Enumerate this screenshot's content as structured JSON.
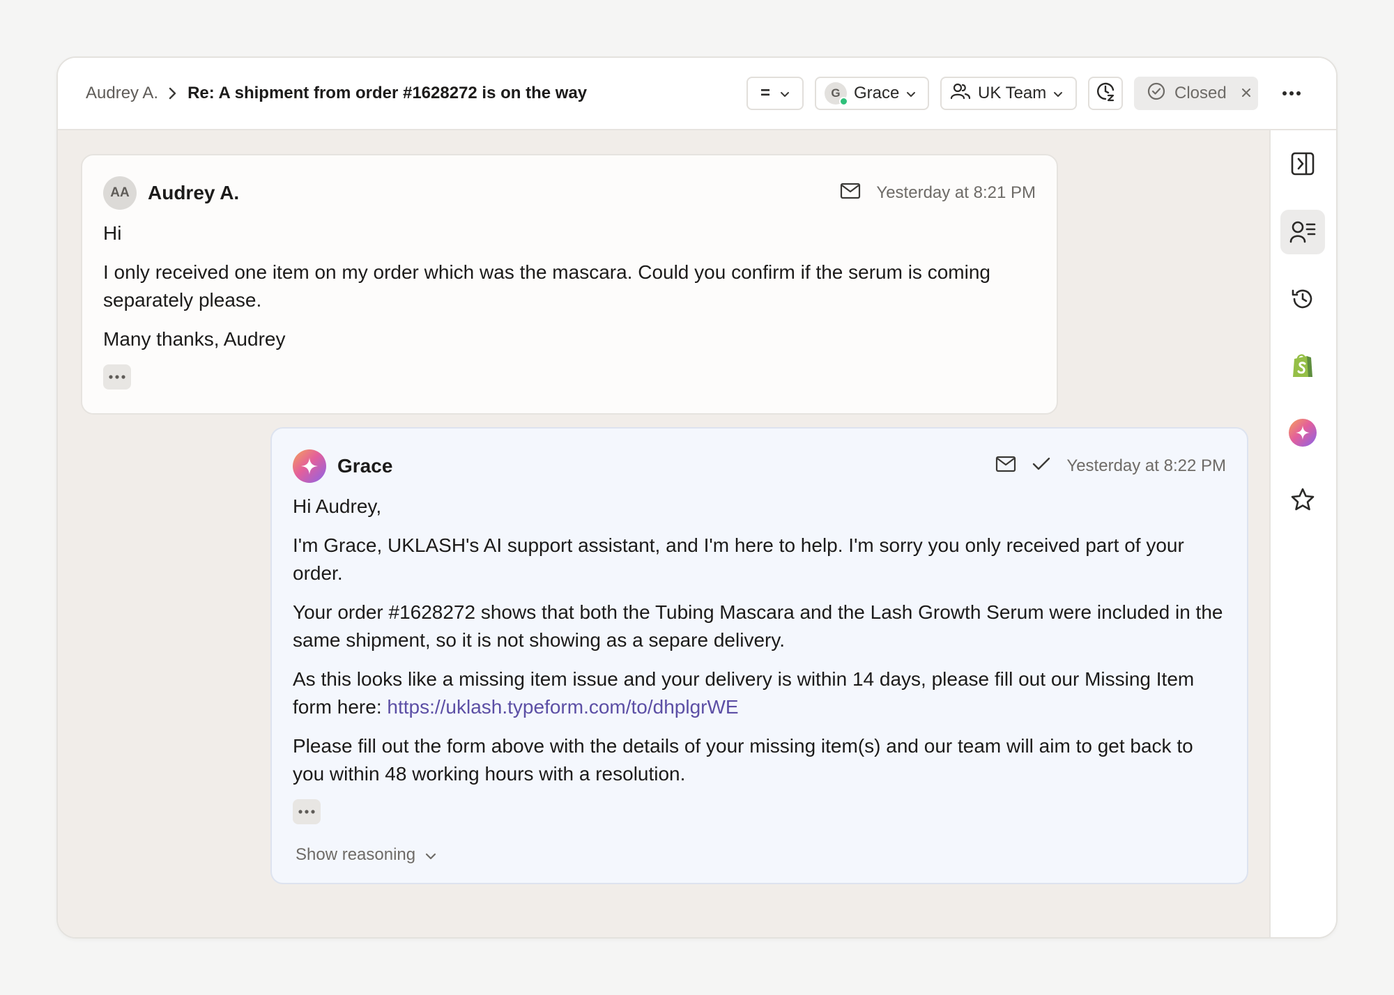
{
  "header": {
    "breadcrumb_parent": "Audrey A.",
    "ticket_title": "Re: A shipment from order #1628272 is on the way",
    "priority_label": "=",
    "assignee_initial": "G",
    "assignee_name": "Grace",
    "team_name": "UK Team",
    "status_label": "Closed"
  },
  "messages": [
    {
      "sender": "Audrey A.",
      "initials": "AA",
      "timestamp": "Yesterday at 8:21 PM",
      "paragraphs": [
        "Hi",
        "I only received one item on my order which was the mascara. Could you confirm if the serum is coming separately please.",
        "Many thanks, Audrey"
      ]
    },
    {
      "sender": "Grace",
      "timestamp": "Yesterday at 8:22 PM",
      "paragraphs": [
        "Hi Audrey,",
        "I'm Grace, UKLASH's AI support assistant, and I'm here to help. I'm sorry you only received part of your order.",
        "Your order #1628272 shows that both the Tubing Mascara and the Lash Growth Serum were included in the same shipment, so it is not showing as a separe delivery.",
        "As this looks like a missing item issue and your delivery is within 14 days, please fill out our Missing Item form here: ",
        "Please fill out the form above with the details of your missing item(s) and our team will aim to get back to you within 48 working hours with a resolution."
      ],
      "link": "https://uklash.typeform.com/to/dhplgrWE",
      "show_reasoning_label": "Show reasoning"
    }
  ],
  "rail": {
    "icons": [
      "sidebar-toggle-icon",
      "contact-details-icon",
      "history-icon",
      "shopify-icon",
      "ai-sparkle-icon",
      "star-icon"
    ]
  },
  "colors": {
    "accent_link": "#5c4fa5",
    "online_dot": "#2fc07a",
    "ai_card_bg": "#f4f7fd",
    "shopify_green": "#95bf47"
  }
}
